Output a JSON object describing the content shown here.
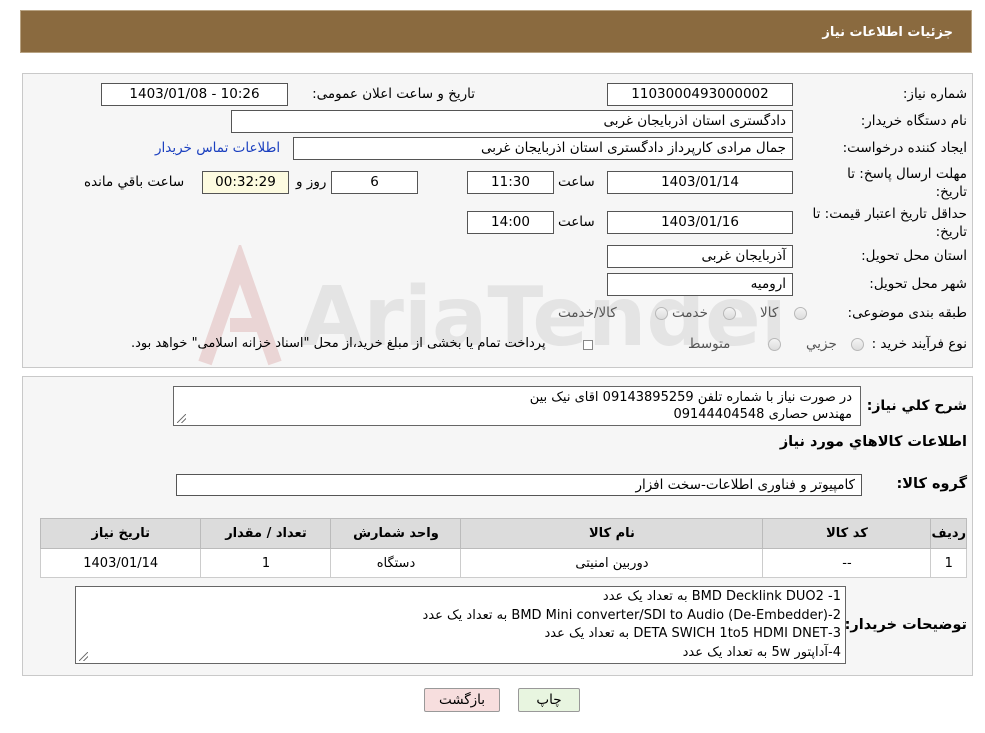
{
  "header": {
    "title": "جزئیات اطلاعات نیاز"
  },
  "form": {
    "need_number_label": "شماره نیاز:",
    "need_number": "1103000493000002",
    "announce_label": "تاریخ و ساعت اعلان عمومی:",
    "announce_value": "1403/01/08 - 10:26",
    "buyer_org_label": "نام دستگاه خریدار:",
    "buyer_org": "دادگستری استان اذربایجان غربی",
    "requester_label": "ایجاد کننده درخواست:",
    "requester": "جمال مرادی کارپرداز دادگستری استان اذربایجان غربی",
    "contact_link": "اطلاعات تماس خریدار",
    "deadline_label_1": "مهلت ارسال پاسخ: تا",
    "deadline_label_2": "تاریخ:",
    "deadline_date": "1403/01/14",
    "time_label": "ساعت",
    "deadline_time": "11:30",
    "days_value": "6",
    "days_label": "روز و",
    "remaining_time": "00:32:29",
    "remaining_label": "ساعت باقي مانده",
    "validity_label_1": "حداقل تاریخ اعتبار قیمت: تا",
    "validity_label_2": "تاریخ:",
    "validity_date": "1403/01/16",
    "validity_time": "14:00",
    "province_label": "استان محل تحویل:",
    "province": "آذربایجان غربی",
    "city_label": "شهر محل تحویل:",
    "city": "ارومیه",
    "category_label": "طبقه بندی موضوعی:",
    "category_options": [
      "کالا",
      "خدمت",
      "کالا/خدمت"
    ],
    "process_label": "نوع فرآیند خرید :",
    "process_options": [
      "جزیي",
      "متوسط"
    ],
    "payment_note": "پرداخت تمام یا بخشی از مبلغ خرید،از محل \"اسناد خزانه اسلامی\" خواهد بود."
  },
  "description": {
    "label": "شرح کلي نياز:",
    "lines": [
      "در صورت نیاز با شماره تلفن 09143895259 اقای نیک بین",
      "مهندس حصاری 09144404548"
    ]
  },
  "goods": {
    "section_title": "اطلاعات کالاهاي مورد نياز",
    "group_label": "گروه کالا:",
    "group_value": "کامپیوتر و فناوری اطلاعات-سخت افزار",
    "columns": [
      "رديف",
      "کد کالا",
      "نام کالا",
      "واحد شمارش",
      "تعداد / مقدار",
      "تاريخ نياز"
    ],
    "rows": [
      [
        "1",
        "--",
        "دوربین امنیتی",
        "دستگاه",
        "1",
        "1403/01/14"
      ]
    ]
  },
  "buyer_notes": {
    "label": "توضیحات خریدار:",
    "lines": [
      "1- BMD Decklink DUO2 به تعداد یک عدد",
      "2-BMD Mini converter/SDI to Audio (De-Embedder)  به تعداد یک عدد",
      "3-DETA SWICH 1to5 HDMI DNET  به تعداد یک عدد",
      "4-آداپتور 5w  به تعداد یک عدد"
    ]
  },
  "buttons": {
    "print": "چاپ",
    "back": "بازگشت"
  },
  "watermark": {
    "text": "AriaTender.neT"
  },
  "colors": {
    "header_bg": "#8a6a3f",
    "link": "#1a3fbf",
    "back_button_bg": "#f7dede",
    "print_button_bg": "#e8f5e0"
  }
}
